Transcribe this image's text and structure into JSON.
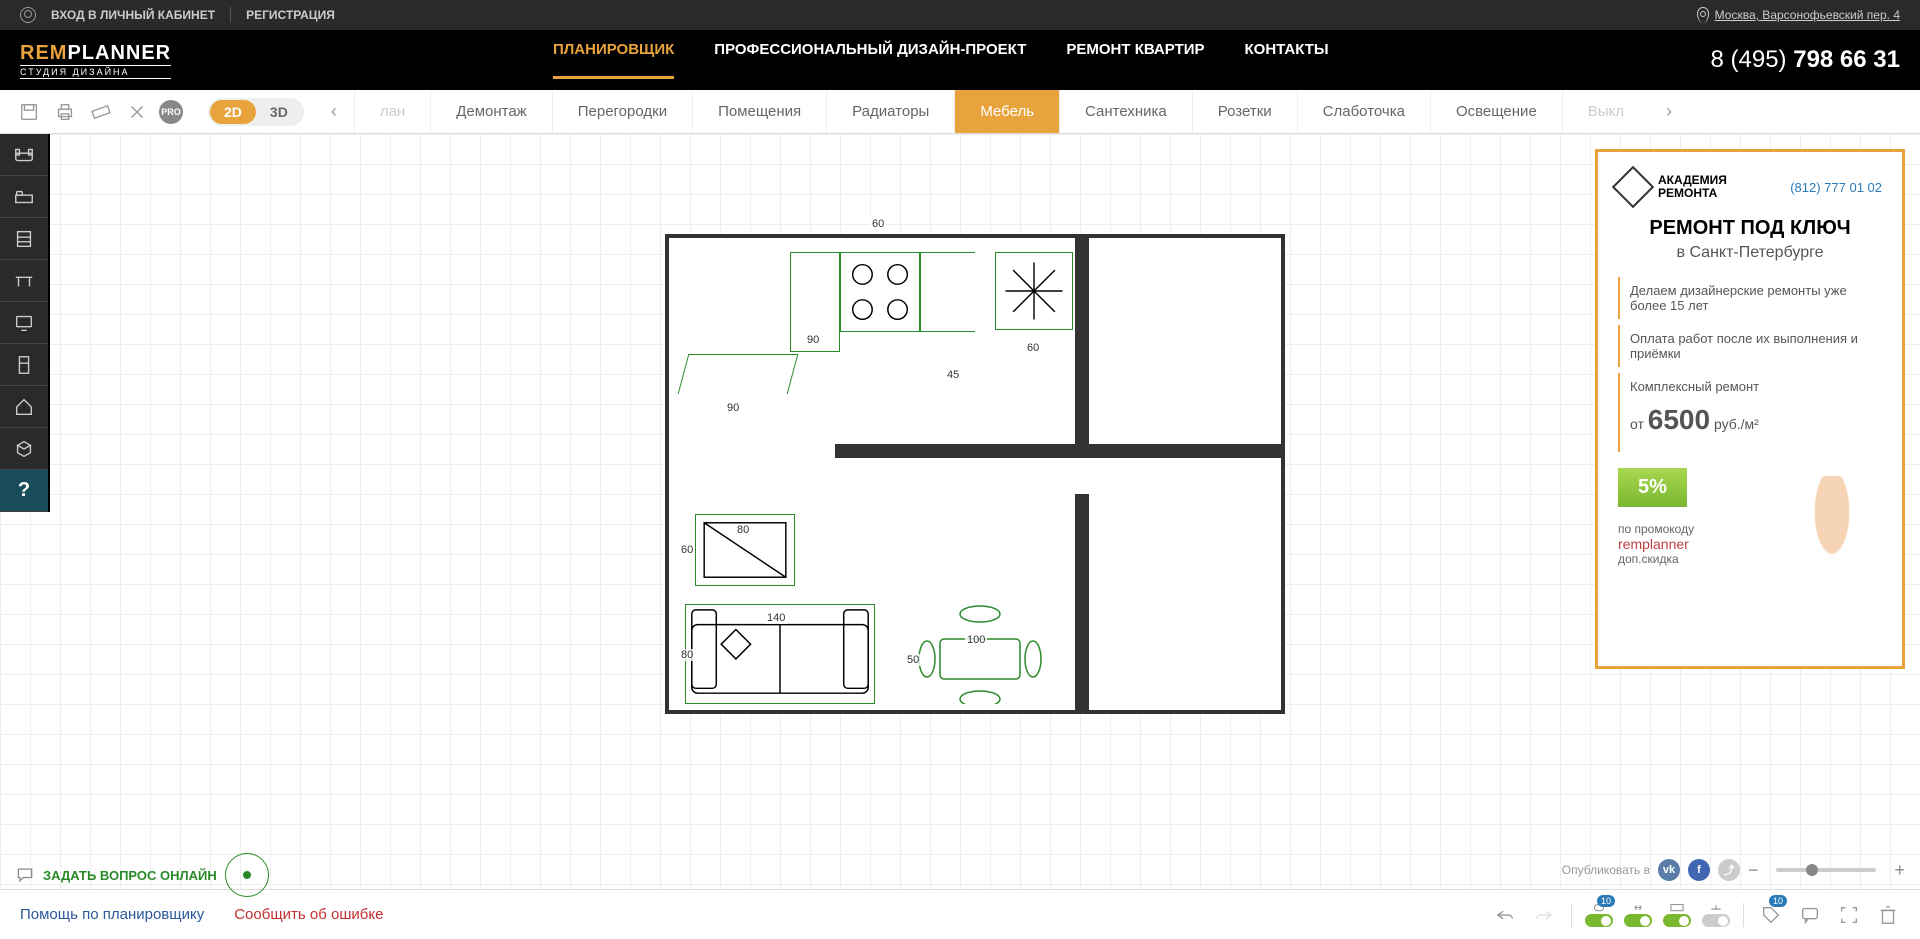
{
  "topbar": {
    "login": "ВХОД В ЛИЧНЫЙ КАБИНЕТ",
    "register": "РЕГИСТРАЦИЯ",
    "location": "Москва, Варсонофьевский пер. 4"
  },
  "header": {
    "logo_rem": "REM",
    "logo_planner": "PLANNER",
    "logo_sub": "СТУДИЯ ДИЗАЙНА",
    "nav": [
      "ПЛАНИРОВЩИК",
      "ПРОФЕССИОНАЛЬНЫЙ ДИЗАЙН-ПРОЕКТ",
      "РЕМОНТ КВАРТИР",
      "КОНТАКТЫ"
    ],
    "phone_prefix": "8 (495) ",
    "phone_bold": "798 66 31"
  },
  "toolbar": {
    "view2d": "2D",
    "view3d": "3D",
    "pro": "PRO",
    "tabs": [
      "лан",
      "Демонтаж",
      "Перегородки",
      "Помещения",
      "Радиаторы",
      "Мебель",
      "Сантехника",
      "Розетки",
      "Слаботочка",
      "Освещение",
      "Выкл"
    ],
    "active_tab": 5
  },
  "plan": {
    "dims": {
      "top": "60",
      "kitchen_w": "90",
      "counter": "90",
      "gap": "45",
      "snow": "60",
      "tv_w": "80",
      "tv_h": "60",
      "sofa_w": "140",
      "sofa_h": "80",
      "table_w": "100",
      "table_h": "50"
    }
  },
  "ad": {
    "brand1": "АКАДЕМИЯ",
    "brand2": "РЕМОНТА",
    "phone": "(812) 777 01 02",
    "title": "РЕМОНТ ПОД КЛЮЧ",
    "sub": "в Санкт-Петербурге",
    "b1": "Делаем дизайнерские ремонты уже более 15 лет",
    "b2": "Оплата работ после их выполнения и приёмки",
    "b3_pre": "Комплексный ремонт",
    "b3_from": "от ",
    "b3_price": "6500",
    "b3_unit": " руб./м²",
    "promo": "5%",
    "promo_pre": "по промокоду",
    "promo_code": "remplanner",
    "promo_post": "доп.скидка"
  },
  "ask": {
    "label": "ЗАДАТЬ ВОПРОС ОНЛАЙН"
  },
  "publish": {
    "label": "Опубликовать в",
    "minus": "−",
    "plus": "+"
  },
  "footer": {
    "help": "Помощь по планировщику",
    "report": "Сообщить об ошибке",
    "badge": "10"
  }
}
